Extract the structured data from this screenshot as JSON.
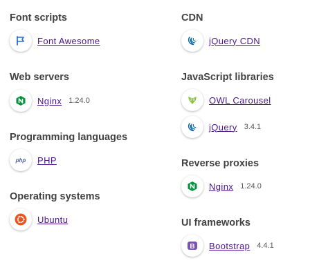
{
  "left_column": {
    "categories": [
      {
        "title": "Font scripts",
        "technologies": [
          {
            "name": "Font Awesome",
            "version": "",
            "icon": "font-awesome-flag-icon",
            "color": "#2b6fd6"
          }
        ]
      },
      {
        "title": "Web servers",
        "technologies": [
          {
            "name": "Nginx",
            "version": "1.24.0",
            "icon": "nginx-icon",
            "color": "#009639"
          }
        ]
      },
      {
        "title": "Programming languages",
        "technologies": [
          {
            "name": "PHP",
            "version": "",
            "icon": "php-icon",
            "color": "#4f5b93"
          }
        ]
      },
      {
        "title": "Operating systems",
        "technologies": [
          {
            "name": "Ubuntu",
            "version": "",
            "icon": "ubuntu-icon",
            "color": "#e95420"
          }
        ]
      }
    ]
  },
  "right_column": {
    "categories": [
      {
        "title": "CDN",
        "technologies": [
          {
            "name": "jQuery CDN",
            "version": "",
            "icon": "jquery-icon",
            "color": "#0868ac"
          }
        ]
      },
      {
        "title": "JavaScript libraries",
        "technologies": [
          {
            "name": "OWL Carousel",
            "version": "",
            "icon": "owl-carousel-icon",
            "color": "#8cc63f"
          },
          {
            "name": "jQuery",
            "version": "3.4.1",
            "icon": "jquery-icon",
            "color": "#0868ac"
          }
        ]
      },
      {
        "title": "Reverse proxies",
        "technologies": [
          {
            "name": "Nginx",
            "version": "1.24.0",
            "icon": "nginx-icon",
            "color": "#009639"
          }
        ]
      },
      {
        "title": "UI frameworks",
        "technologies": [
          {
            "name": "Bootstrap",
            "version": "4.4.1",
            "icon": "bootstrap-icon",
            "color": "#7952b3"
          }
        ]
      }
    ]
  },
  "colors": {
    "link": "#4a148c",
    "heading": "#424242",
    "version": "#555555"
  }
}
